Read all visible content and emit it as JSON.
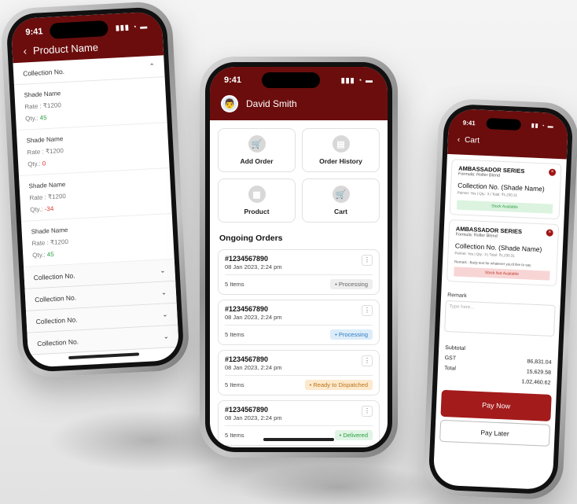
{
  "status_time": "9:41",
  "product_screen": {
    "title": "Product Name",
    "collection_header": "Collection No.",
    "shades": [
      {
        "name": "Shade Name",
        "rate": "Rate : ₹1200",
        "qty_label": "Qty.:",
        "qty": "45",
        "qty_color": "green"
      },
      {
        "name": "Shade Name",
        "rate": "Rate : ₹1200",
        "qty_label": "Qty.:",
        "qty": "0",
        "qty_color": "red"
      },
      {
        "name": "Shade Name",
        "rate": "Rate : ₹1200",
        "qty_label": "Qty.:",
        "qty": "-34",
        "qty_color": "red"
      },
      {
        "name": "Shade Name",
        "rate": "Rate : ₹1200",
        "qty_label": "Qty.:",
        "qty": "45",
        "qty_color": "green"
      }
    ],
    "collections": [
      "Collection No.",
      "Collection No.",
      "Collection No.",
      "Collection No."
    ]
  },
  "home_screen": {
    "user_name": "David Smith",
    "tiles": [
      {
        "label": "Add Order",
        "icon": "cart-add-icon"
      },
      {
        "label": "Order History",
        "icon": "document-icon"
      },
      {
        "label": "Product",
        "icon": "boxes-icon"
      },
      {
        "label": "Cart",
        "icon": "cart-icon"
      }
    ],
    "section_title": "Ongoing Orders",
    "orders": [
      {
        "id": "#1234567890",
        "date": "08 Jan 2023, 2:24 pm",
        "items": "5 Items",
        "status": "Processing",
        "style": "b-proc"
      },
      {
        "id": "#1234567890",
        "date": "08 Jan 2023, 2:24 pm",
        "items": "5 Items",
        "status": "Processing",
        "style": "b-proc2"
      },
      {
        "id": "#1234567890",
        "date": "08 Jan 2023, 2:24 pm",
        "items": "5 Items",
        "status": "Ready to Dispatched",
        "style": "b-ready"
      },
      {
        "id": "#1234567890",
        "date": "08 Jan 2023, 2:24 pm",
        "items": "5 Items",
        "status": "Delivered",
        "style": "b-del"
      }
    ]
  },
  "cart_screen": {
    "title": "Cart",
    "items": [
      {
        "series": "AMBASSADOR SERIES",
        "formula": "Formula: Roller Blend",
        "collection": "Collection No. (Shade Name)",
        "meta": "Pelmet: Yes | Qty.: 3 | Total: ₹1,230.31",
        "remark": "",
        "stock": "Stock Available",
        "stock_ok": true
      },
      {
        "series": "AMBASSADOR SERIES",
        "formula": "Formula: Roller Blend",
        "collection": "Collection No. (Shade Name)",
        "meta": "Pelmet: Yes | Qty.: 3 | Total: ₹1,230.31",
        "remark": "Remark : Body text for whatever you'd like to say.",
        "stock": "Stock Not Available",
        "stock_ok": false
      }
    ],
    "remark_label": "Remark",
    "remark_placeholder": "Type here...",
    "subtotal_label": "Subtotal",
    "subtotal": "86,831.04",
    "gst_label": "GST",
    "gst": "15,629.58",
    "total_label": "Total",
    "total": "1,02,460.62",
    "pay_now": "Pay Now",
    "pay_later": "Pay Later"
  }
}
